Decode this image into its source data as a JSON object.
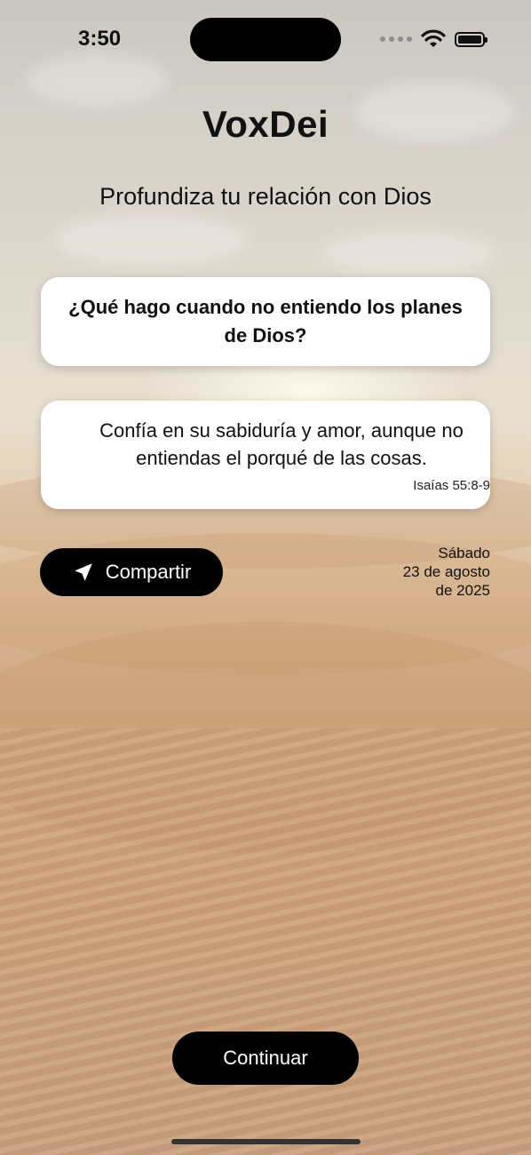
{
  "status_bar": {
    "time": "3:50"
  },
  "header": {
    "title": "VoxDei",
    "subtitle": "Profundiza tu relación con Dios"
  },
  "question": {
    "text": "¿Qué hago cuando no entiendo los planes de Dios?"
  },
  "answer": {
    "text": "Confía en su sabiduría y amor, aunque no entiendas el porqué de las cosas.",
    "reference": "Isaías 55:8-9"
  },
  "share": {
    "label": "Compartir",
    "icon": "send-icon"
  },
  "date": {
    "weekday": "Sábado",
    "day_month": "23 de agosto",
    "year": "de 2025"
  },
  "footer": {
    "continue_label": "Continuar"
  }
}
